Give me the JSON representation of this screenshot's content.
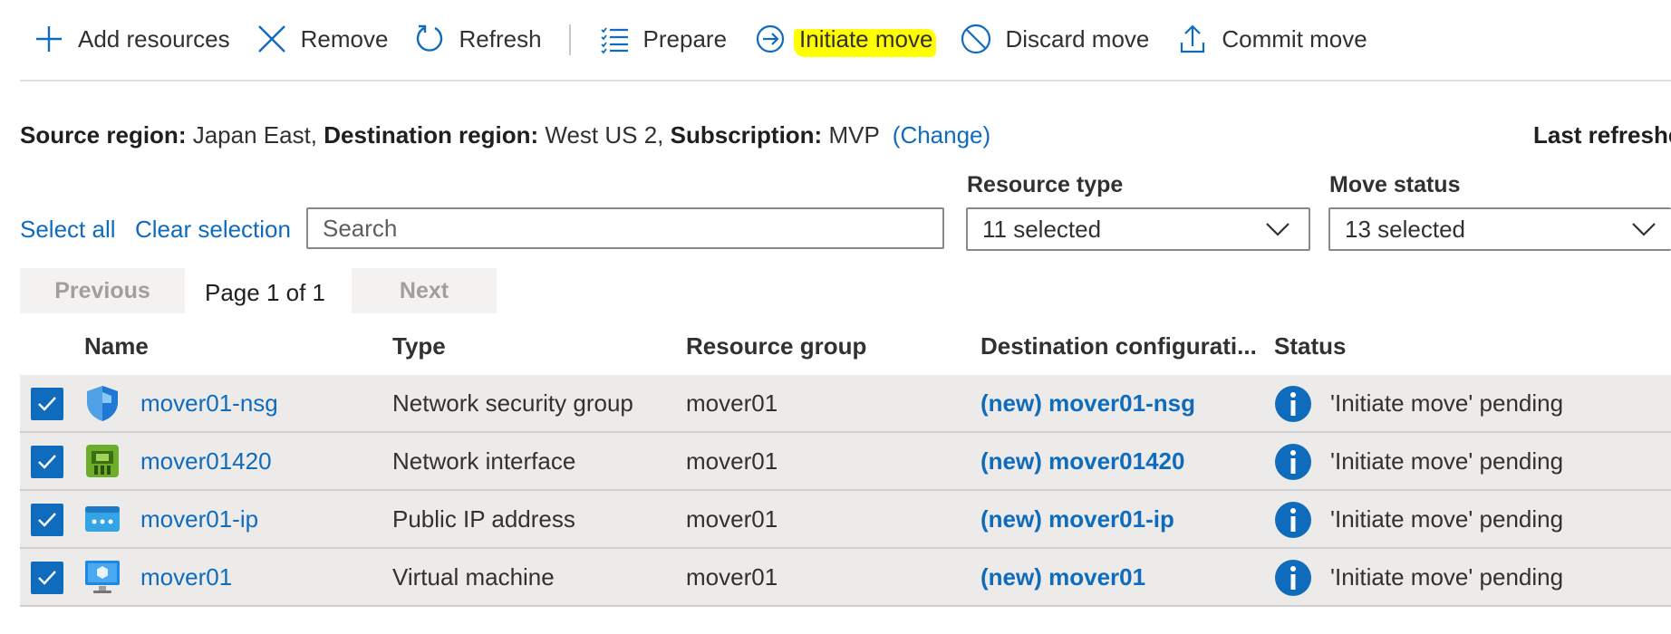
{
  "toolbar": {
    "add_resources": "Add resources",
    "remove": "Remove",
    "refresh": "Refresh",
    "prepare": "Prepare",
    "initiate_move": "Initiate move",
    "discard_move": "Discard move",
    "commit_move": "Commit move",
    "highlight_color": "#ffff00"
  },
  "info": {
    "source_label": "Source region:",
    "source_value": "Japan East,",
    "dest_label": "Destination region:",
    "dest_value": "West US 2,",
    "sub_label": "Subscription:",
    "sub_value": "MVP",
    "change_link": "(Change)",
    "last_refreshed": "Last refreshe"
  },
  "filters": {
    "select_all": "Select all",
    "clear_selection": "Clear selection",
    "search_placeholder": "Search",
    "resource_type_label": "Resource type",
    "resource_type_value": "11 selected",
    "move_status_label": "Move status",
    "move_status_value": "13 selected"
  },
  "pagination": {
    "previous": "Previous",
    "page_text": "Page 1 of 1",
    "next": "Next"
  },
  "table": {
    "headers": {
      "name": "Name",
      "type": "Type",
      "resource_group": "Resource group",
      "destination": "Destination configurati...",
      "status": "Status"
    },
    "rows": [
      {
        "name": "mover01-nsg",
        "icon": "network-security-group-icon",
        "type": "Network security group",
        "resource_group": "mover01",
        "destination": "(new) mover01-nsg",
        "status": "'Initiate move' pending",
        "checked": true
      },
      {
        "name": "mover01420",
        "icon": "network-interface-icon",
        "type": "Network interface",
        "resource_group": "mover01",
        "destination": "(new) mover01420",
        "status": "'Initiate move' pending",
        "checked": true
      },
      {
        "name": "mover01-ip",
        "icon": "public-ip-icon",
        "type": "Public IP address",
        "resource_group": "mover01",
        "destination": "(new) mover01-ip",
        "status": "'Initiate move' pending",
        "checked": true
      },
      {
        "name": "mover01",
        "icon": "virtual-machine-icon",
        "type": "Virtual machine",
        "resource_group": "mover01",
        "destination": "(new) mover01",
        "status": "'Initiate move' pending",
        "checked": true
      }
    ]
  },
  "colors": {
    "link": "#0f6cbd",
    "row_background": "#edebe9",
    "info_icon": "#0f6cbd"
  }
}
